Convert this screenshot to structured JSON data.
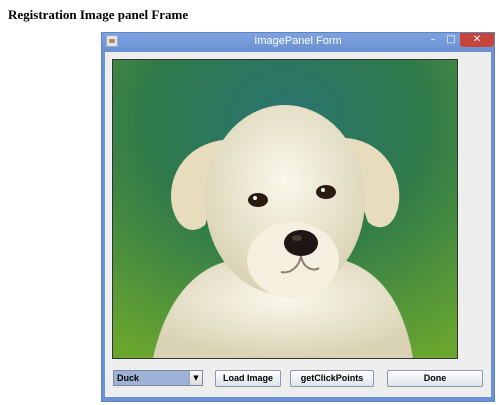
{
  "page": {
    "caption": "Registration Image panel Frame"
  },
  "window": {
    "title": "ImagePanel Form",
    "minimize_glyph": "–",
    "maximize_glyph": "□",
    "close_glyph": "✕"
  },
  "controls": {
    "combo": {
      "selected": "Duck",
      "arrow_glyph": "▼"
    },
    "load_label": "Load Image",
    "click_points_label": "getClickPoints",
    "done_label": "Done"
  },
  "image": {
    "subject": "white puppy photo"
  }
}
